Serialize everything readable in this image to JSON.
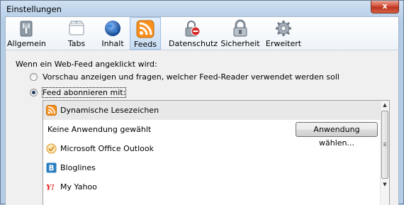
{
  "window": {
    "title": "Einstellungen",
    "close_glyph": "x"
  },
  "toolbar": {
    "tabs": [
      {
        "label": "Allgemein",
        "icon": "general-switch-icon"
      },
      {
        "label": "Tabs",
        "icon": "tabs-icon"
      },
      {
        "label": "Inhalt",
        "icon": "globe-icon"
      },
      {
        "label": "Feeds",
        "icon": "rss-feed-icon",
        "active": true
      },
      {
        "label": "Datenschutz",
        "icon": "privacy-icon"
      },
      {
        "label": "Sicherheit",
        "icon": "padlock-icon"
      },
      {
        "label": "Erweitert",
        "icon": "gear-icon"
      }
    ]
  },
  "feeds": {
    "intro": "Wenn ein Web-Feed angeklickt wird:",
    "option_preview": "Vorschau anzeigen und fragen, welcher Feed-Reader verwendet werden soll",
    "option_subscribe": "Feed abonnieren mit:",
    "selected_option": "option_subscribe",
    "readers": [
      {
        "label": "Dynamische Lesezeichen",
        "icon": "rss-feed-icon",
        "selected": true
      },
      {
        "label": "Keine Anwendung gewählt",
        "button": "Anwendung wählen..."
      },
      {
        "label": "Microsoft Office Outlook",
        "icon": "outlook-icon"
      },
      {
        "label": "Bloglines",
        "icon": "bloglines-icon"
      },
      {
        "label": "My Yahoo",
        "icon": "yahoo-icon"
      }
    ]
  },
  "colors": {
    "accent": "#f7901e",
    "selected_tab": "#c7dcf3",
    "close": "#d1462f"
  }
}
